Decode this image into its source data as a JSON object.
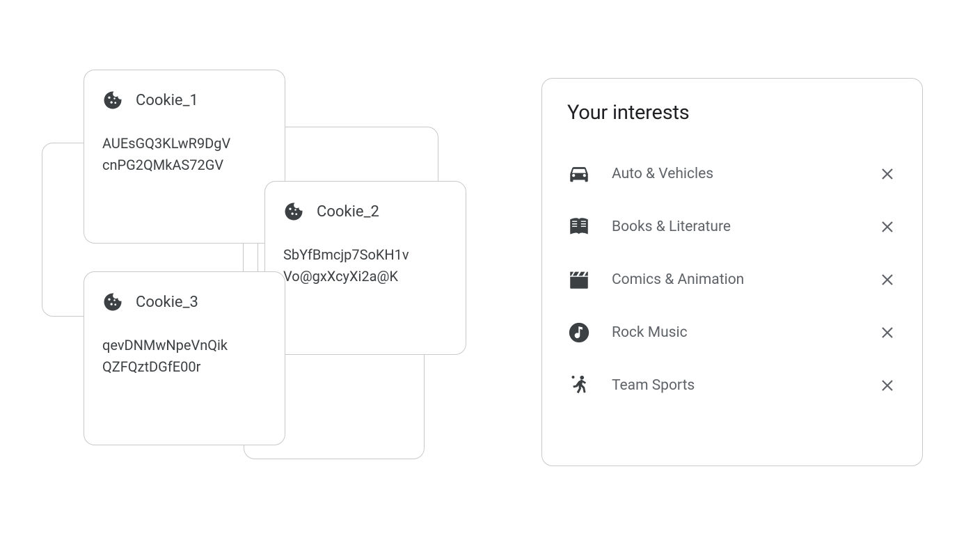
{
  "cookies": [
    {
      "title": "Cookie_1",
      "line1": "AUEsGQ3KLwR9DgV",
      "line2": "cnPG2QMkAS72GV"
    },
    {
      "title": "Cookie_2",
      "line1": "SbYfBmcjp7SoKH1v",
      "line2": "Vo@gxXcyXi2a@K"
    },
    {
      "title": "Cookie_3",
      "line1": "qevDNMwNpeVnQik",
      "line2": "QZFQztDGfE00r"
    }
  ],
  "interests": {
    "heading": "Your interests",
    "items": [
      {
        "label": "Auto & Vehicles",
        "icon": "car-icon"
      },
      {
        "label": "Books & Literature",
        "icon": "book-icon"
      },
      {
        "label": "Comics & Animation",
        "icon": "clapperboard-icon"
      },
      {
        "label": "Rock Music",
        "icon": "music-note-icon"
      },
      {
        "label": "Team Sports",
        "icon": "sports-icon"
      }
    ]
  }
}
